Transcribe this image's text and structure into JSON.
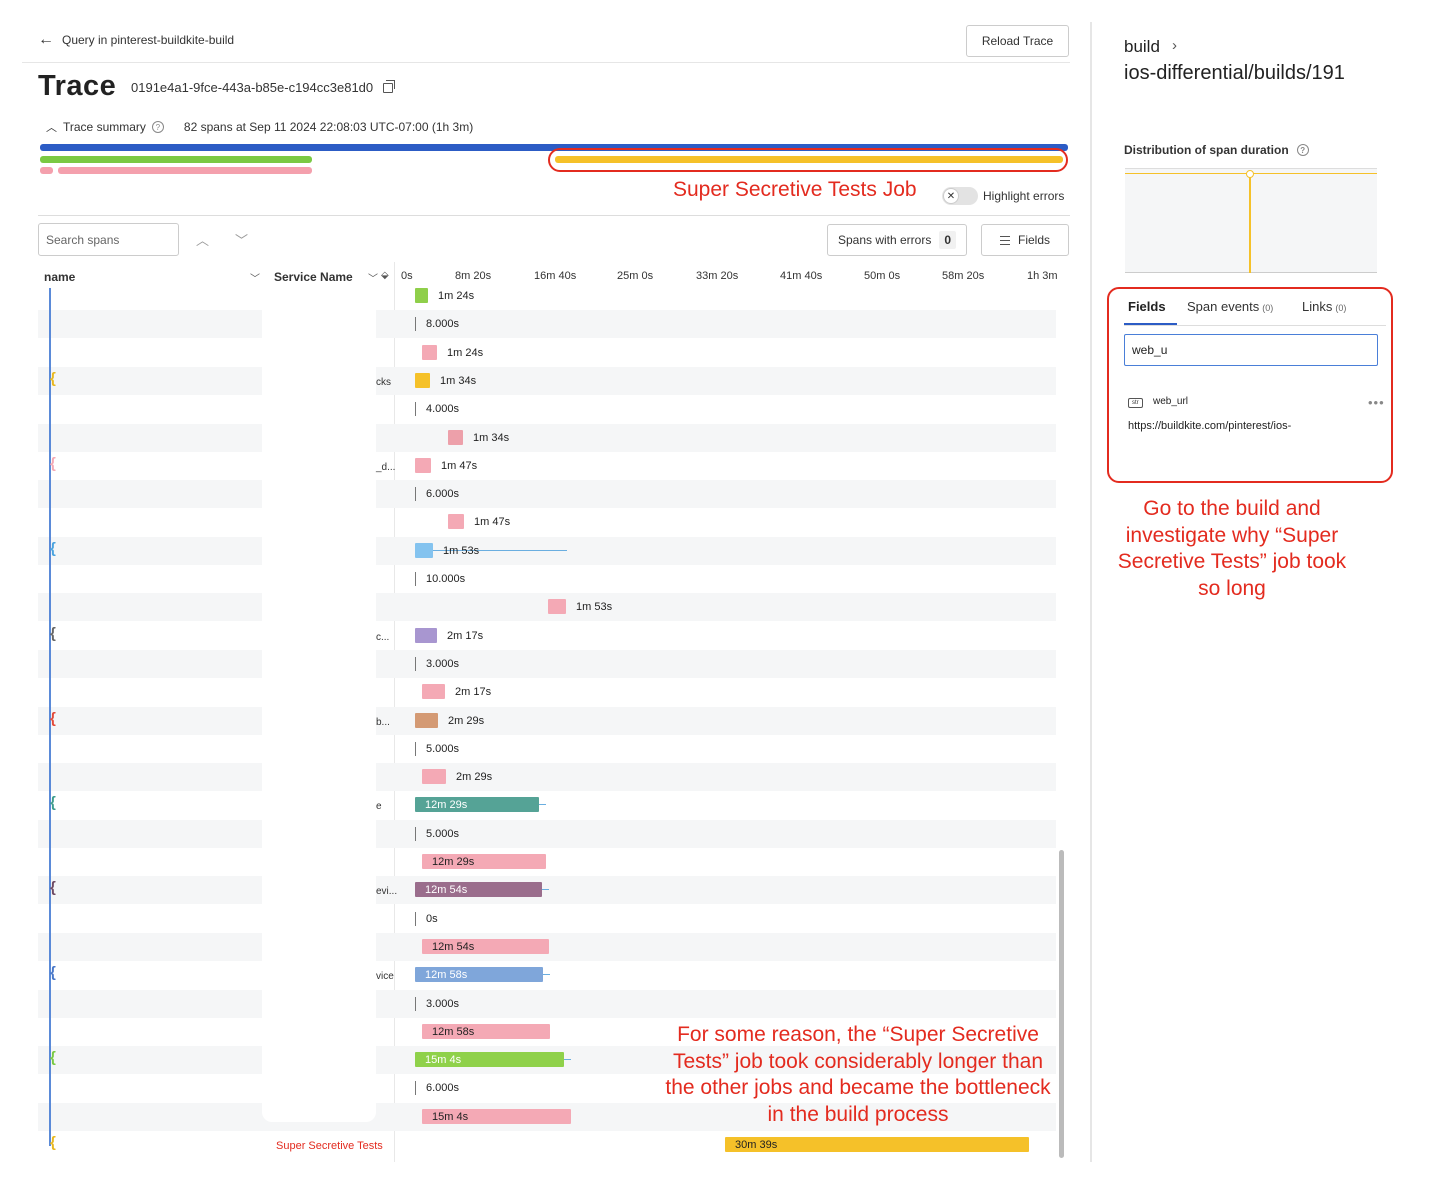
{
  "header": {
    "back_label": "Query in pinterest-buildkite-build",
    "reload_label": "Reload Trace",
    "title": "Trace",
    "trace_id": "0191e4a1-9fce-443a-b85e-c194cc3e81d0"
  },
  "summary": {
    "label": "Trace summary",
    "meta": "82 spans at Sep 11 2024 22:08:03 UTC-07:00 (1h 3m)"
  },
  "annotations": {
    "job_label": "Super Secretive Tests Job",
    "reason": "For some reason, the “Super Secretive Tests” job took considerably longer than the other jobs and became the bottleneck in the build process",
    "goto": "Go to the build and investigate why “Super Secretive Tests” job took so long"
  },
  "toolbar": {
    "highlight_errors": "Highlight errors",
    "search_placeholder": "Search spans",
    "spans_with_errors": "Spans with errors",
    "errors_count": "0",
    "fields_label": "Fields"
  },
  "table": {
    "col_name": "name",
    "col_service": "Service Name",
    "axis_ticks": [
      "0s",
      "8m 20s",
      "16m 40s",
      "25m 0s",
      "33m 20s",
      "41m 40s",
      "50m 0s",
      "58m 20s",
      "1h 3m"
    ]
  },
  "spans": [
    {
      "duration": "1m 24s",
      "color": "#8fcf4a",
      "kind": "bar"
    },
    {
      "duration": "8.000s",
      "kind": "tick"
    },
    {
      "duration": "1m 24s",
      "color": "#f4a9b5",
      "kind": "bar"
    },
    {
      "duration": "1m 34s",
      "color": "#f5c129",
      "kind": "bar",
      "service": "cks",
      "bracket_color": "#e8b820"
    },
    {
      "duration": "4.000s",
      "kind": "tick"
    },
    {
      "duration": "1m 34s",
      "color": "#eda0aa",
      "kind": "bar"
    },
    {
      "duration": "1m 47s",
      "color": "#f4a9b5",
      "kind": "bar",
      "service": "_d...",
      "bracket_color": "#f4a9b5"
    },
    {
      "duration": "6.000s",
      "kind": "tick"
    },
    {
      "duration": "1m 47s",
      "color": "#f4a9b5",
      "kind": "bar"
    },
    {
      "duration": "1m 53s",
      "color": "#84c3ef",
      "kind": "bar",
      "bracket_color": "#4aa3df"
    },
    {
      "duration": "10.000s",
      "kind": "tick"
    },
    {
      "duration": "1m 53s",
      "color": "#f4a9b5",
      "kind": "bar"
    },
    {
      "duration": "2m 17s",
      "color": "#a896d0",
      "kind": "bar",
      "service": "c...",
      "bracket_color": "#666666"
    },
    {
      "duration": "3.000s",
      "kind": "tick"
    },
    {
      "duration": "2m 17s",
      "color": "#f4a9b5",
      "kind": "bar"
    },
    {
      "duration": "2m 29s",
      "color": "#d49a74",
      "kind": "bar",
      "service": "b...",
      "bracket_color": "#e24a3a"
    },
    {
      "duration": "5.000s",
      "kind": "tick"
    },
    {
      "duration": "2m 29s",
      "color": "#f4a9b5",
      "kind": "bar"
    },
    {
      "duration": "12m 29s",
      "color": "#55a396",
      "kind": "bar",
      "service": "e",
      "bracket_color": "#3f9c8d"
    },
    {
      "duration": "5.000s",
      "kind": "tick"
    },
    {
      "duration": "12m 29s",
      "color": "#f4a9b5",
      "kind": "bar"
    },
    {
      "duration": "12m 54s",
      "color": "#9a6d8c",
      "kind": "bar",
      "service": "evi...",
      "bracket_color": "#6e4a63"
    },
    {
      "duration": "0s",
      "kind": "tick"
    },
    {
      "duration": "12m 54s",
      "color": "#f4a9b5",
      "kind": "bar"
    },
    {
      "duration": "12m 58s",
      "color": "#7fa6da",
      "kind": "bar",
      "service": "vice",
      "bracket_color": "#4a78c8"
    },
    {
      "duration": "3.000s",
      "kind": "tick"
    },
    {
      "duration": "12m 58s",
      "color": "#f4a9b5",
      "kind": "bar"
    },
    {
      "duration": "15m 4s",
      "color": "#8fd14a",
      "kind": "bar",
      "bracket_color": "#7ac943"
    },
    {
      "duration": "6.000s",
      "kind": "tick"
    },
    {
      "duration": "15m 4s",
      "color": "#f4a9b5",
      "kind": "bar"
    },
    {
      "duration": "30m 39s",
      "color": "#f5c129",
      "kind": "bar",
      "service": "Super Secretive Tests",
      "bracket_color": "#e8b820"
    }
  ],
  "panel": {
    "breadcrumb_root": "build",
    "breadcrumb_path": "ios-differential/builds/191",
    "dist_title": "Distribution of span duration",
    "tabs": [
      {
        "label": "Fields",
        "count": ""
      },
      {
        "label": "Span events",
        "count": "(0)"
      },
      {
        "label": "Links",
        "count": "(0)"
      }
    ],
    "field_search_value": "web_u",
    "field_type": "str",
    "field_key": "web_url",
    "field_value": "https://buildkite.com/pinterest/ios-"
  }
}
